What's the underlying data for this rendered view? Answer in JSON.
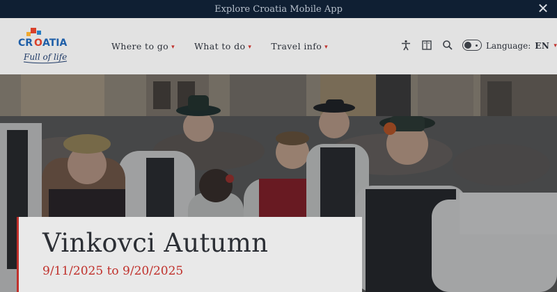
{
  "banner": {
    "text": "Explore Croatia Mobile App",
    "close_icon": "close-icon"
  },
  "header": {
    "logo": {
      "word": "CROATIA",
      "tagline": "Full of life"
    },
    "nav": [
      {
        "label": "Where to go"
      },
      {
        "label": "What to do"
      },
      {
        "label": "Travel info"
      }
    ],
    "tools": [
      "accessibility-icon",
      "book-icon",
      "search-icon",
      "theme-toggle-icon"
    ],
    "language": {
      "label": "Language:",
      "code": "EN"
    }
  },
  "event": {
    "title": "Vinkovci Autumn",
    "dates": "9/11/2025 to 9/20/2025"
  },
  "colors": {
    "banner_bg": "#0f1f33",
    "accent_red": "#c0302b",
    "text_dark": "#2a2f38"
  }
}
